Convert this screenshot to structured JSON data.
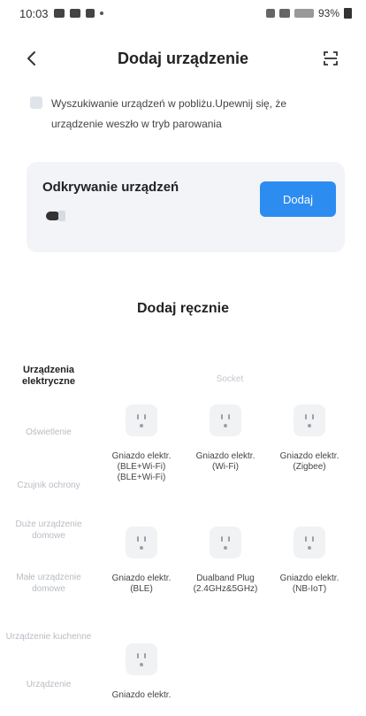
{
  "status_bar": {
    "time": "10:03",
    "battery": "93%"
  },
  "header": {
    "title": "Dodaj urządzenie"
  },
  "hint": {
    "text": "Wyszukiwanie urządzeń w pobliżu.Upewnij się, że urządzenie weszło w tryb parowania"
  },
  "discover": {
    "title": "Odkrywanie urządzeń",
    "add_label": "Dodaj"
  },
  "manual": {
    "title": "Dodaj ręcznie"
  },
  "categories": [
    {
      "label": "Urządzenia elektryczne",
      "active": true
    },
    {
      "label": "Oświetlenie"
    },
    {
      "label": "Czujnik ochrony"
    },
    {
      "label": "Duże urządzenie domowe"
    },
    {
      "label": "Małe urządzenie domowe"
    },
    {
      "label": "Urządzenie kuchenne"
    },
    {
      "label": "Urządzenie"
    }
  ],
  "subcategory": {
    "title": "Socket"
  },
  "devices": [
    {
      "label": "Gniazdo elektr. (BLE+Wi-Fi) (BLE+Wi-Fi)"
    },
    {
      "label": "Gniazdo elektr. (Wi-Fi)"
    },
    {
      "label": "Gniazdo elektr. (Zigbee)"
    },
    {
      "label": "Gniazdo elektr. (BLE)"
    },
    {
      "label": "Dualband Plug (2.4GHz&5GHz)"
    },
    {
      "label": "Gniazdo elektr. (NB-IoT)"
    },
    {
      "label": "Gniazdo elektr."
    }
  ],
  "colors": {
    "accent": "#2d8cf0",
    "card_bg": "#f2f4f8"
  }
}
